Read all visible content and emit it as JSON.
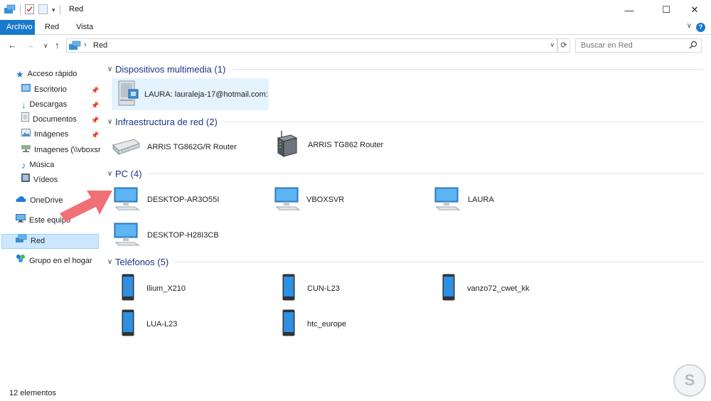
{
  "window": {
    "title": "Red",
    "controls": {
      "minimize": "—",
      "maximize": "☐",
      "close": "✕"
    }
  },
  "ribbon": {
    "tabs": [
      {
        "label": "Archivo",
        "active": true
      },
      {
        "label": "Red",
        "active": false
      },
      {
        "label": "Vista",
        "active": false
      }
    ],
    "help": "?"
  },
  "address": {
    "crumb": "Red",
    "search_placeholder": "Buscar en Red"
  },
  "nav": {
    "items": [
      {
        "label": "Acceso rápido",
        "icon": "star-icon"
      },
      {
        "label": "Escritorio",
        "icon": "desktop-folder-icon",
        "pinned": true
      },
      {
        "label": "Descargas",
        "icon": "download-icon",
        "pinned": true
      },
      {
        "label": "Documentos",
        "icon": "document-icon",
        "pinned": true
      },
      {
        "label": "Imágenes",
        "icon": "pictures-icon",
        "pinned": true
      },
      {
        "label": "Imagenes (\\\\vboxsr",
        "icon": "network-drive-icon"
      },
      {
        "label": "Música",
        "icon": "music-icon"
      },
      {
        "label": "Vídeos",
        "icon": "video-icon"
      },
      {
        "label": "OneDrive",
        "icon": "cloud-icon"
      },
      {
        "label": "Este equipo",
        "icon": "computer-icon"
      },
      {
        "label": "Red",
        "icon": "network-icon",
        "selected": true
      },
      {
        "label": "Grupo en el hogar",
        "icon": "homegroup-icon"
      }
    ]
  },
  "groups": [
    {
      "title": "Dispositivos multimedia (1)",
      "items": [
        "LAURA: lauraleja-17@hotmail.com:"
      ]
    },
    {
      "title": "Infraestructura de red (2)",
      "items": [
        "ARRIS TG862G/R Router",
        "ARRIS TG862 Router"
      ]
    },
    {
      "title": "PC (4)",
      "items": [
        "DESKTOP-AR3O55I",
        "VBOXSVR",
        "LAURA",
        "DESKTOP-H28I3CB"
      ]
    },
    {
      "title": "Teléfonos (5)",
      "items": [
        "Ilium_X210",
        "CUN-L23",
        "vanzo72_cwet_kk",
        "LUA-L23",
        "htc_europe"
      ]
    }
  ],
  "status": {
    "count": "12 elementos"
  },
  "colors": {
    "accent": "#1979ca",
    "group_title": "#1e3287",
    "arrow": "#f0686e"
  }
}
